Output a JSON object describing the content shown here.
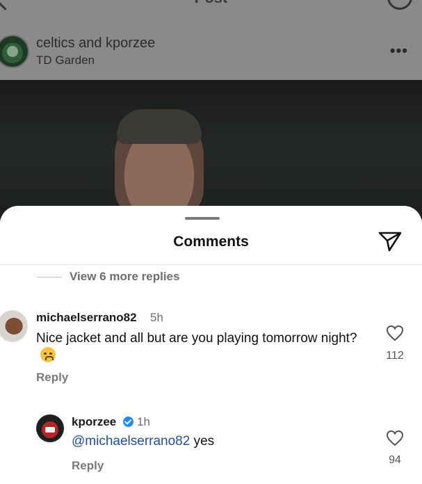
{
  "header": {
    "title": "Post"
  },
  "post": {
    "username": "celtics and kporzee",
    "location": "TD Garden",
    "more_label": "•••"
  },
  "comments_sheet": {
    "title": "Comments",
    "view_more_replies": "View 6 more replies",
    "comments": [
      {
        "username": "michaelserrano82",
        "time": "5h",
        "text": "Nice jacket and all but are you playing tomorrow night?",
        "emoji": "weary-face",
        "reply_label": "Reply",
        "likes": "112"
      },
      {
        "username": "kporzee",
        "verified": true,
        "time": "1h",
        "mention": "@michaelserrano82",
        "text": " yes",
        "reply_label": "Reply",
        "likes": "94"
      }
    ]
  },
  "colors": {
    "mention": "#1f4fa0",
    "verified_badge": "#1f8bf0",
    "overlay": "#7f7f7f"
  }
}
